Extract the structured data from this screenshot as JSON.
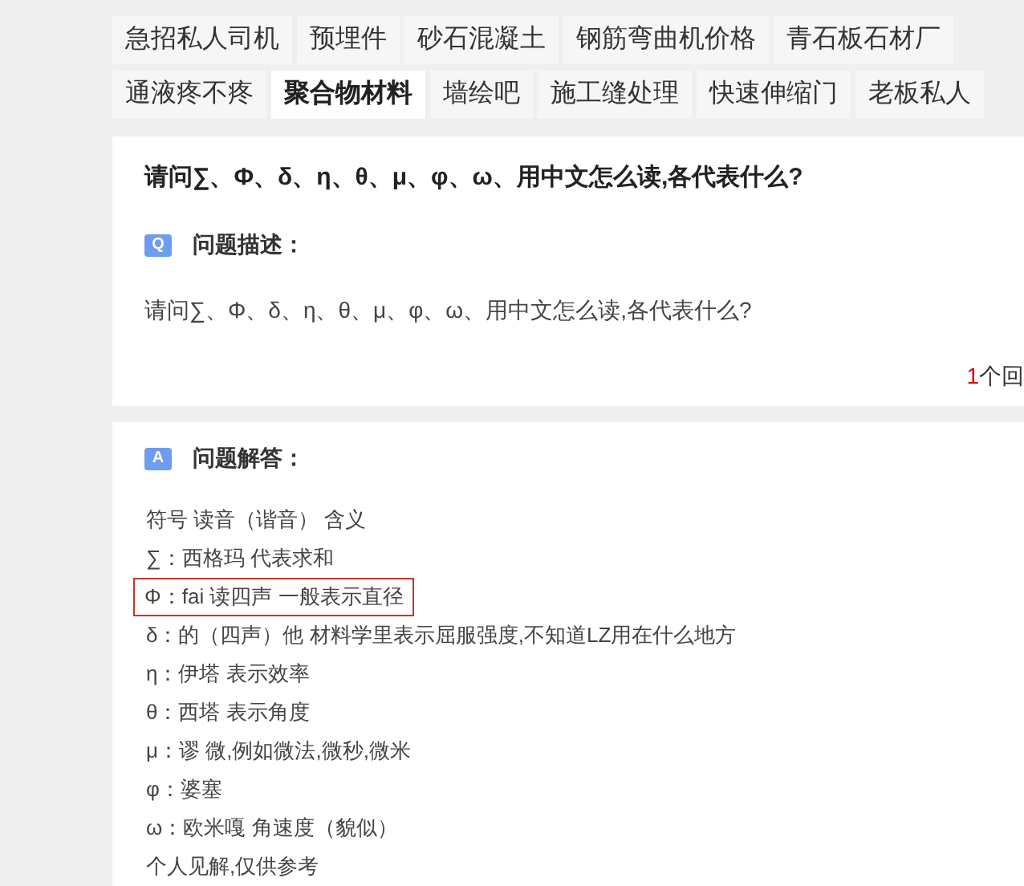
{
  "tag_rows": [
    [
      {
        "label": "急招私人司机",
        "selected": false
      },
      {
        "label": "预埋件",
        "selected": false
      },
      {
        "label": "砂石混凝土",
        "selected": false
      },
      {
        "label": "钢筋弯曲机价格",
        "selected": false
      },
      {
        "label": "青石板石材厂",
        "selected": false
      }
    ],
    [
      {
        "label": "通液疼不疼",
        "selected": false
      },
      {
        "label": "聚合物材料",
        "selected": true
      },
      {
        "label": "墙绘吧",
        "selected": false
      },
      {
        "label": "施工缝处理",
        "selected": false
      },
      {
        "label": "快速伸缩门",
        "selected": false
      },
      {
        "label": "老板私人",
        "selected": false
      }
    ]
  ],
  "question": {
    "title": "请问∑、Φ、δ、η、θ、μ、φ、ω、用中文怎么读,各代表什么?",
    "badge": "Q",
    "label": "问题描述：",
    "description": "请问∑、Φ、δ、η、θ、μ、φ、ω、用中文怎么读,各代表什么?",
    "answer_count": "1",
    "answer_count_text": "个回"
  },
  "answer": {
    "badge": "A",
    "label": "问题解答：",
    "lines": [
      {
        "text": "符号 读音（谐音） 含义",
        "highlighted": false
      },
      {
        "text": "∑：西格玛 代表求和",
        "highlighted": false
      },
      {
        "text": "Φ：fai 读四声 一般表示直径",
        "highlighted": true
      },
      {
        "text": "δ：的（四声）他 材料学里表示屈服强度,不知道LZ用在什么地方",
        "highlighted": false
      },
      {
        "text": "η：伊塔 表示效率",
        "highlighted": false
      },
      {
        "text": "θ：西塔 表示角度",
        "highlighted": false
      },
      {
        "text": "μ：谬 微,例如微法,微秒,微米",
        "highlighted": false
      },
      {
        "text": "φ：婆塞",
        "highlighted": false
      },
      {
        "text": "ω：欧米嘎 角速度（貌似）",
        "highlighted": false
      },
      {
        "text": "个人见解,仅供参考",
        "highlighted": false
      }
    ]
  }
}
